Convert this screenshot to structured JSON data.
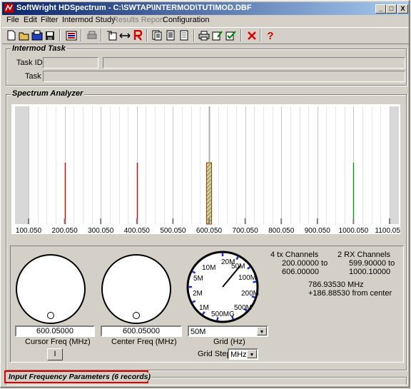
{
  "window": {
    "title": "SoftWright HDSpectrum - C:\\SWTAP\\INTERMOD\\TUTIMOD.DBF",
    "minimize": "_",
    "maximize": "□",
    "close": "X"
  },
  "menu": {
    "items": [
      "File",
      "Edit",
      "Filter",
      "Intermod Study",
      "Results Report",
      "Configuration"
    ]
  },
  "toolbar": {
    "icons": [
      "new-icon",
      "open-icon",
      "open-database-icon",
      "save-icon",
      "list-icon",
      "print-preview-icon",
      "import-icon",
      "expand-icon",
      "report-r-icon",
      "print-icon",
      "document-icon",
      "document-lines-icon",
      "printer-icon",
      "edit-icon",
      "checkbox-icon",
      "delete-x-icon",
      "help-icon"
    ]
  },
  "intermod_task": {
    "title": "Intermod Task",
    "task_id_label": "Task ID:",
    "task_label": "Task",
    "task_id_value": "",
    "task_id_desc": "",
    "task_value": ""
  },
  "spectrum": {
    "title": "Spectrum Analyzer",
    "tick_labels": [
      "100.050",
      "200.050",
      "300.050",
      "400.050",
      "500.050",
      "600.050",
      "700.050",
      "800.050",
      "900.050",
      "1000.050",
      "1100.050"
    ]
  },
  "chart_data": {
    "type": "bar",
    "xlabel": "",
    "ylabel": "",
    "xlim": [
      100.05,
      1100.05
    ],
    "x_ticks": [
      100.05,
      200.05,
      300.05,
      400.05,
      500.05,
      600.05,
      700.05,
      800.05,
      900.05,
      1000.05,
      1100.05
    ],
    "grid": true,
    "series": [
      {
        "values": [
          200.05,
          400.05
        ],
        "color": "#cc0000"
      },
      {
        "values": [
          1000.05
        ],
        "color": "#00a000"
      }
    ],
    "center_band": {
      "low": 593.0,
      "high": 607.0,
      "color": "#d07000"
    }
  },
  "controls": {
    "cursor_freq_value": "600.05000",
    "cursor_freq_label": "Cursor Freq (MHz)",
    "center_freq_value": "600.05000",
    "center_freq_label": "Center Freq (MHz)",
    "grid_value": "50M",
    "grid_label": "Grid (Hz)",
    "grid_step_label": "Grid Step",
    "grid_step_value": "MHz",
    "cursor_button": "I",
    "dial_labels": [
      "20M",
      "50M",
      "10M",
      "100M",
      "5M",
      "200M",
      "2M",
      "500M",
      "1M",
      "500MG"
    ]
  },
  "info": {
    "tx_title": "4 tx Channels",
    "tx_range1": "200.00000 to",
    "tx_range2": "606.00000",
    "rx_title": "2 RX Channels",
    "rx_range1": "599.90000 to",
    "rx_range2": "1000.10000",
    "cursor_mhz": "786.93530 MHz",
    "from_center": "+186.88530 from center"
  },
  "input_params": {
    "title": "Input Frequency Parameters (6 records)",
    "highlight_color": "#e00000"
  }
}
